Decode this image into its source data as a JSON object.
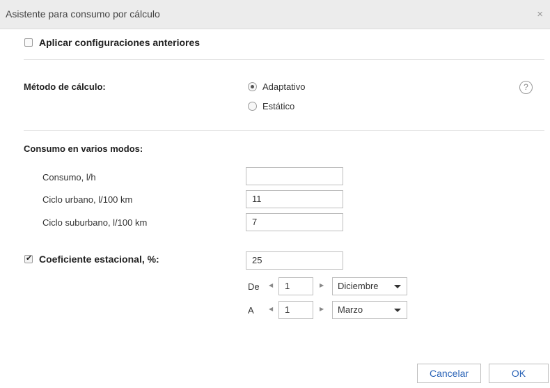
{
  "dialog": {
    "title": "Asistente para consumo por cálculo",
    "close_icon": "×"
  },
  "apply_previous": {
    "label": "Aplicar configuraciones anteriores",
    "checked": false
  },
  "calc_method": {
    "label": "Método de cálculo:",
    "options": [
      "Adaptativo",
      "Estático"
    ],
    "selected": "Adaptativo",
    "help_icon": "?"
  },
  "consumption_modes": {
    "heading": "Consumo en varios modos:",
    "rows": [
      {
        "label": "Consumo, l/h",
        "value": ""
      },
      {
        "label": "Ciclo urbano, l/100 km",
        "value": "11"
      },
      {
        "label": "Ciclo suburbano, l/100 km",
        "value": "7"
      }
    ]
  },
  "seasonal": {
    "label": "Coeficiente estacional, %:",
    "checked": true,
    "value": "25",
    "from_label": "De",
    "from_day": "1",
    "from_month": "Diciembre",
    "to_label": "A",
    "to_day": "1",
    "to_month": "Marzo"
  },
  "buttons": {
    "cancel": "Cancelar",
    "ok": "OK"
  }
}
